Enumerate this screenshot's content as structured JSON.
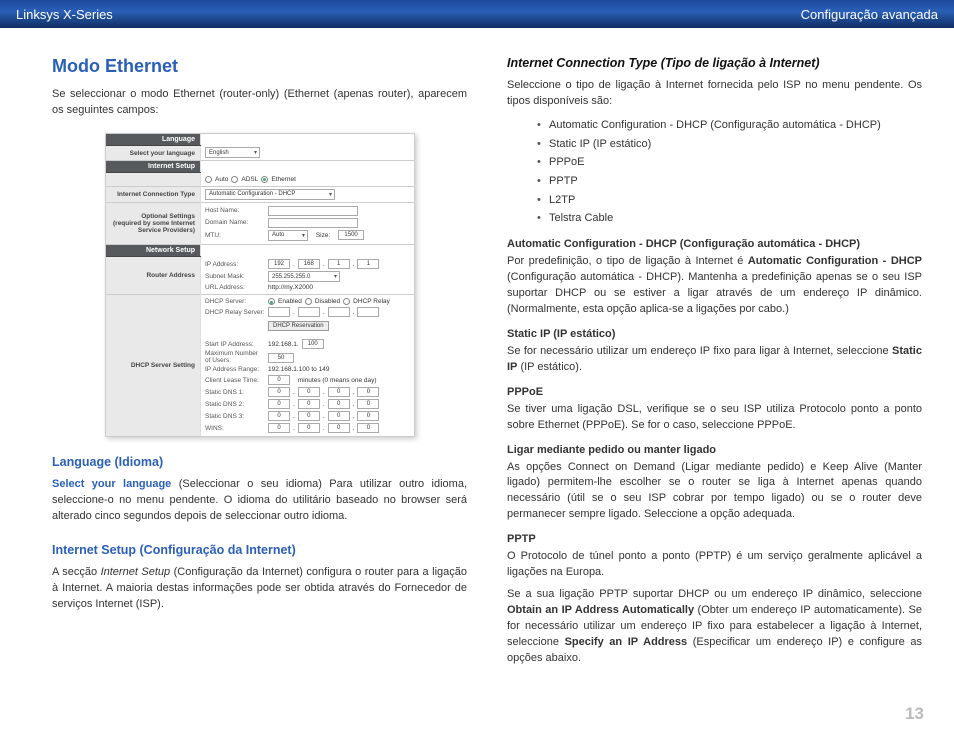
{
  "header": {
    "left": "Linksys X-Series",
    "right": "Configuração avançada"
  },
  "page_number": "13",
  "left": {
    "title": "Modo Ethernet",
    "intro": "Se seleccionar o modo Ethernet (router-only) (Ethernet (apenas router), aparecem os seguintes campos:",
    "lang_heading": "Language (Idioma)",
    "lang_lead": "Select your language",
    "lang_para": " (Seleccionar o seu idioma) Para utilizar outro idioma, seleccione-o no menu pendente. O idioma do utilitário baseado no browser será alterado cinco segundos depois de seleccionar outro idioma.",
    "setup_heading": "Internet Setup (Configuração da Internet)",
    "setup_para_a": "A secção ",
    "setup_para_em": "Internet Setup",
    "setup_para_b": " (Configuração da Internet) configura o router para a ligação à Internet. A maioria destas informações pode ser obtida através do Fornecedor de serviços Internet (ISP)."
  },
  "panel": {
    "sections": {
      "language": "Language",
      "select_language": "Select your language",
      "english": "English",
      "internet_setup": "Internet Setup",
      "auto": "Auto",
      "adsl": "ADSL",
      "ethernet": "Ethernet",
      "ict": "Internet Connection Type",
      "auto_dhcp": "Automatic Configuration - DHCP",
      "optional": "Optional Settings\n(required by some Internet Service Providers)",
      "host": "Host Name:",
      "domain": "Domain Name:",
      "mtu": "MTU:",
      "mtu_auto": "Auto",
      "size": "Size:",
      "size_val": "1500",
      "network_setup": "Network Setup",
      "router_addr": "Router Address",
      "ip": "IP Address:",
      "ip_vals": [
        "192",
        "168",
        "1",
        "1"
      ],
      "subnet": "Subnet Mask:",
      "subnet_val": "255.255.255.0",
      "url": "URL Address:",
      "url_val": "http://my.X2000",
      "dhcp_srv_setting": "DHCP Server Setting",
      "dhcp_server": "DHCP Server:",
      "enabled": "Enabled",
      "disabled": "Disabled",
      "relay": "DHCP Relay",
      "relay_server": "DHCP Relay Server:",
      "reservation": "DHCP Reservation",
      "start_ip": "Start IP Address:",
      "start_ip_val": "192.168.1.",
      "start_ip_last": "100",
      "max_users": "Maximum Number of Users:",
      "max_users_val": "50",
      "range_label": "IP Address Range:",
      "range_val": "192.168.1.100 to 149",
      "lease": "Client Lease Time:",
      "lease_val": "0",
      "lease_suffix": "minutes (0 means one day)",
      "dns1": "Static DNS 1:",
      "dns2": "Static DNS 2:",
      "dns3": "Static DNS 3:",
      "wins": "WINS:"
    }
  },
  "right": {
    "ict_heading": "Internet Connection Type (Tipo de ligação à Internet)",
    "ict_intro": "Seleccione o tipo de ligação à Internet fornecida pelo ISP no menu pendente. Os tipos disponíveis são:",
    "types": [
      "Automatic Configuration - DHCP (Configuração automática - DHCP)",
      "Static IP (IP estático)",
      "PPPoE",
      "PPTP",
      "L2TP",
      "Telstra Cable"
    ],
    "auto_head": "Automatic Configuration - DHCP (Configuração automática - DHCP)",
    "auto_p_a": "Por predefinição, o tipo de ligação à Internet é ",
    "auto_p_b": "Automatic Configuration - DHCP",
    "auto_p_c": " (Configuração automática - DHCP). Mantenha a predefinição apenas se o seu ISP suportar DHCP ou se estiver a ligar através de um endereço IP dinâmico. (Normalmente, esta opção aplica-se a ligações por cabo.)",
    "static_head": "Static IP (IP estático)",
    "static_p_a": "Se for necessário utilizar um endereço IP fixo para ligar à Internet, seleccione ",
    "static_p_b": "Static IP",
    "static_p_c": " (IP estático).",
    "pppoe_head": "PPPoE",
    "pppoe_p": "Se tiver uma ligação DSL, verifique se o seu ISP utiliza Protocolo ponto a ponto sobre Ethernet (PPPoE). Se for o caso, seleccione PPPoE.",
    "connect_head": "Ligar mediante pedido ou manter ligado",
    "connect_p": "As opções Connect on Demand (Ligar mediante pedido) e Keep Alive (Manter ligado) permitem-lhe escolher se o router se liga à Internet apenas quando necessário (útil se o seu ISP cobrar por tempo ligado) ou se o router deve permanecer sempre ligado. Seleccione a opção adequada.",
    "pptp_head": "PPTP",
    "pptp_p1": "O Protocolo de túnel ponto a ponto (PPTP) é um serviço geralmente aplicável a ligações na Europa.",
    "pptp_p2_a": "Se a sua ligação PPTP suportar DHCP ou um endereço IP dinâmico, seleccione ",
    "pptp_p2_b": "Obtain an IP Address Automatically",
    "pptp_p2_c": " (Obter um endereço IP automaticamente). Se for necessário utilizar um endereço IP fixo para estabelecer a ligação à Internet, seleccione ",
    "pptp_p2_d": "Specify an IP Address",
    "pptp_p2_e": " (Especificar um endereço IP) e configure as opções abaixo."
  }
}
